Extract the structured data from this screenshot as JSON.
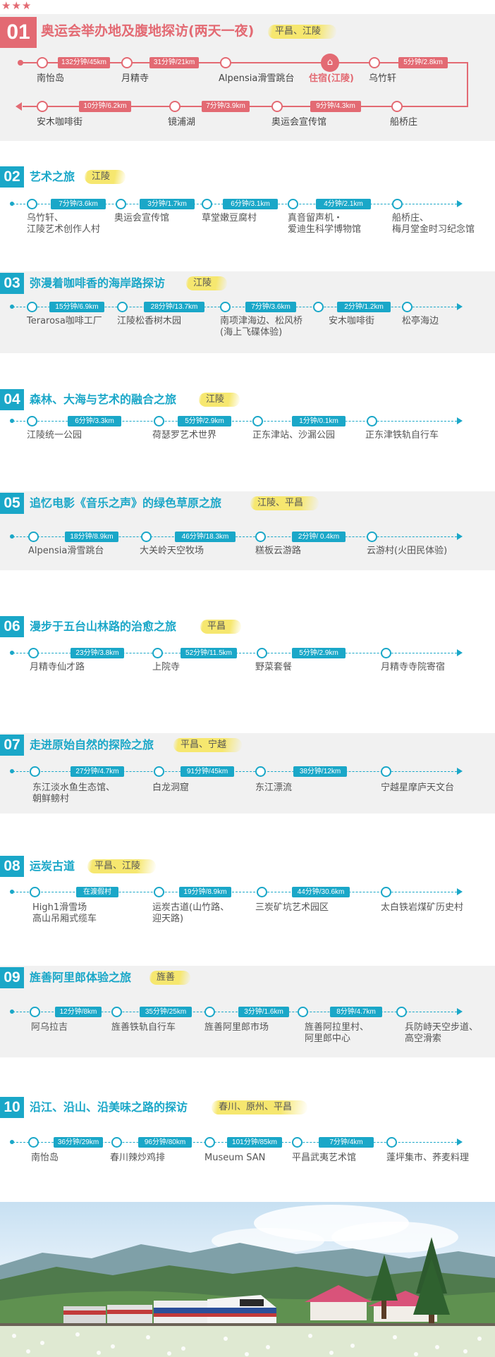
{
  "stars": "★★★",
  "route1": {
    "num": "01",
    "title": "奥运会举办地及腹地探访(两天一夜)",
    "tag": "平昌、江陵",
    "row1": {
      "stops": [
        "南怡岛",
        "月精寺",
        "Alpensia滑雪跳台",
        "住宿(江陵)",
        "乌竹轩"
      ],
      "pills": [
        "132分钟/45km",
        "31分钟/21km",
        "5分钟/2.8km"
      ]
    },
    "row2": {
      "stops": [
        "安木咖啡街",
        "镜浦湖",
        "奥运会宣传馆",
        "船桥庄"
      ],
      "pills": [
        "10分钟/6.2km",
        "7分钟/3.9km",
        "9分钟/4.3km"
      ]
    }
  },
  "routes": [
    {
      "num": "02",
      "title": "艺术之旅",
      "tag": "江陵",
      "stops": [
        "乌竹轩、\n江陵艺术创作人村",
        "奥运会宣传馆",
        "草堂嫩豆腐村",
        "真音留声机・\n爱迪生科学博物馆",
        "船桥庄、\n梅月堂金时习纪念馆"
      ],
      "pills": [
        "7分钟/3.6km",
        "3分钟/1.7km",
        "6分钟/3.1km",
        "4分钟/2.1km"
      ]
    },
    {
      "num": "03",
      "title": "弥漫着咖啡香的海岸路探访",
      "tag": "江陵",
      "stops": [
        "Terarosa咖啡工厂",
        "江陵松香树木园",
        "南项津海边、松风桥\n(海上飞碟体验)",
        "安木咖啡街",
        "松亭海边"
      ],
      "pills": [
        "15分钟/6.9km",
        "28分钟/13.7km",
        "7分钟/3.6km",
        "2分钟/1.2km"
      ]
    },
    {
      "num": "04",
      "title": "森林、大海与艺术的融合之旅",
      "tag": "江陵",
      "stops": [
        "江陵统一公园",
        "荷瑟罗艺术世界",
        "正东津站、沙漏公园",
        "正东津铁轨自行车"
      ],
      "pills": [
        "6分钟/3.3km",
        "5分钟/2.9km",
        "1分钟/0.1km"
      ]
    },
    {
      "num": "05",
      "title": "追忆电影《音乐之声》的绿色草原之旅",
      "tag": "江陵、平昌",
      "stops": [
        "Alpensia滑雪跳台",
        "大关岭天空牧场",
        "糕板云游路",
        "云游村(火田民体验)"
      ],
      "pills": [
        "18分钟/8.9km",
        "46分钟/18.3km",
        "2分钟/ 0.4km"
      ]
    },
    {
      "num": "06",
      "title": "漫步于五台山林路的治愈之旅",
      "tag": "平昌",
      "stops": [
        "月精寺仙才路",
        "上院寺",
        "野菜套餐",
        "月精寺寺院寄宿"
      ],
      "pills": [
        "23分钟/3.8km",
        "52分钟/11.5km",
        "5分钟/2.9km"
      ]
    },
    {
      "num": "07",
      "title": "走进原始自然的探险之旅",
      "tag": "平昌、宁越",
      "stops": [
        "东江淡水鱼生态馆、\n朝鲜鳑村",
        "白龙洞窟",
        "东江漂流",
        "宁越星摩庐天文台"
      ],
      "pills": [
        "27分钟/4.7km",
        "91分钟/45km",
        "38分钟/12km"
      ]
    },
    {
      "num": "08",
      "title": "运炭古道",
      "tag": "平昌、江陵",
      "stops": [
        "High1滑雪场\n高山吊厢式缆车",
        "运炭古道(山竹路、\n迎天路)",
        "三炭矿坑艺术园区",
        "太白铁岩煤矿历史村"
      ],
      "pills": [
        "在渡假村",
        "19分钟/8.9km",
        "44分钟/30.6km"
      ]
    },
    {
      "num": "09",
      "title": "旌善阿里郎体验之旅",
      "tag": "旌善",
      "stops": [
        "阿乌拉吉",
        "旌善铁轨自行车",
        "旌善阿里郎市场",
        "旌善阿拉里村、\n阿里郎中心",
        "兵防峙天空步道、\n高空滑索"
      ],
      "pills": [
        "12分钟/8km",
        "35分钟/25km",
        "3分钟/1.6km",
        "8分钟/4.7km"
      ]
    },
    {
      "num": "10",
      "title": "沿江、沿山、沿美味之路的探访",
      "tag": "春川、原州、平昌",
      "stops": [
        "南怡岛",
        "春川辣炒鸡排",
        "Museum SAN",
        "平昌武夷艺术馆",
        "蓬坪集市、荞麦料理"
      ],
      "pills": [
        "36分钟/29km",
        "96分钟/80km",
        "101分钟/85km",
        "7分钟/4km"
      ]
    }
  ]
}
